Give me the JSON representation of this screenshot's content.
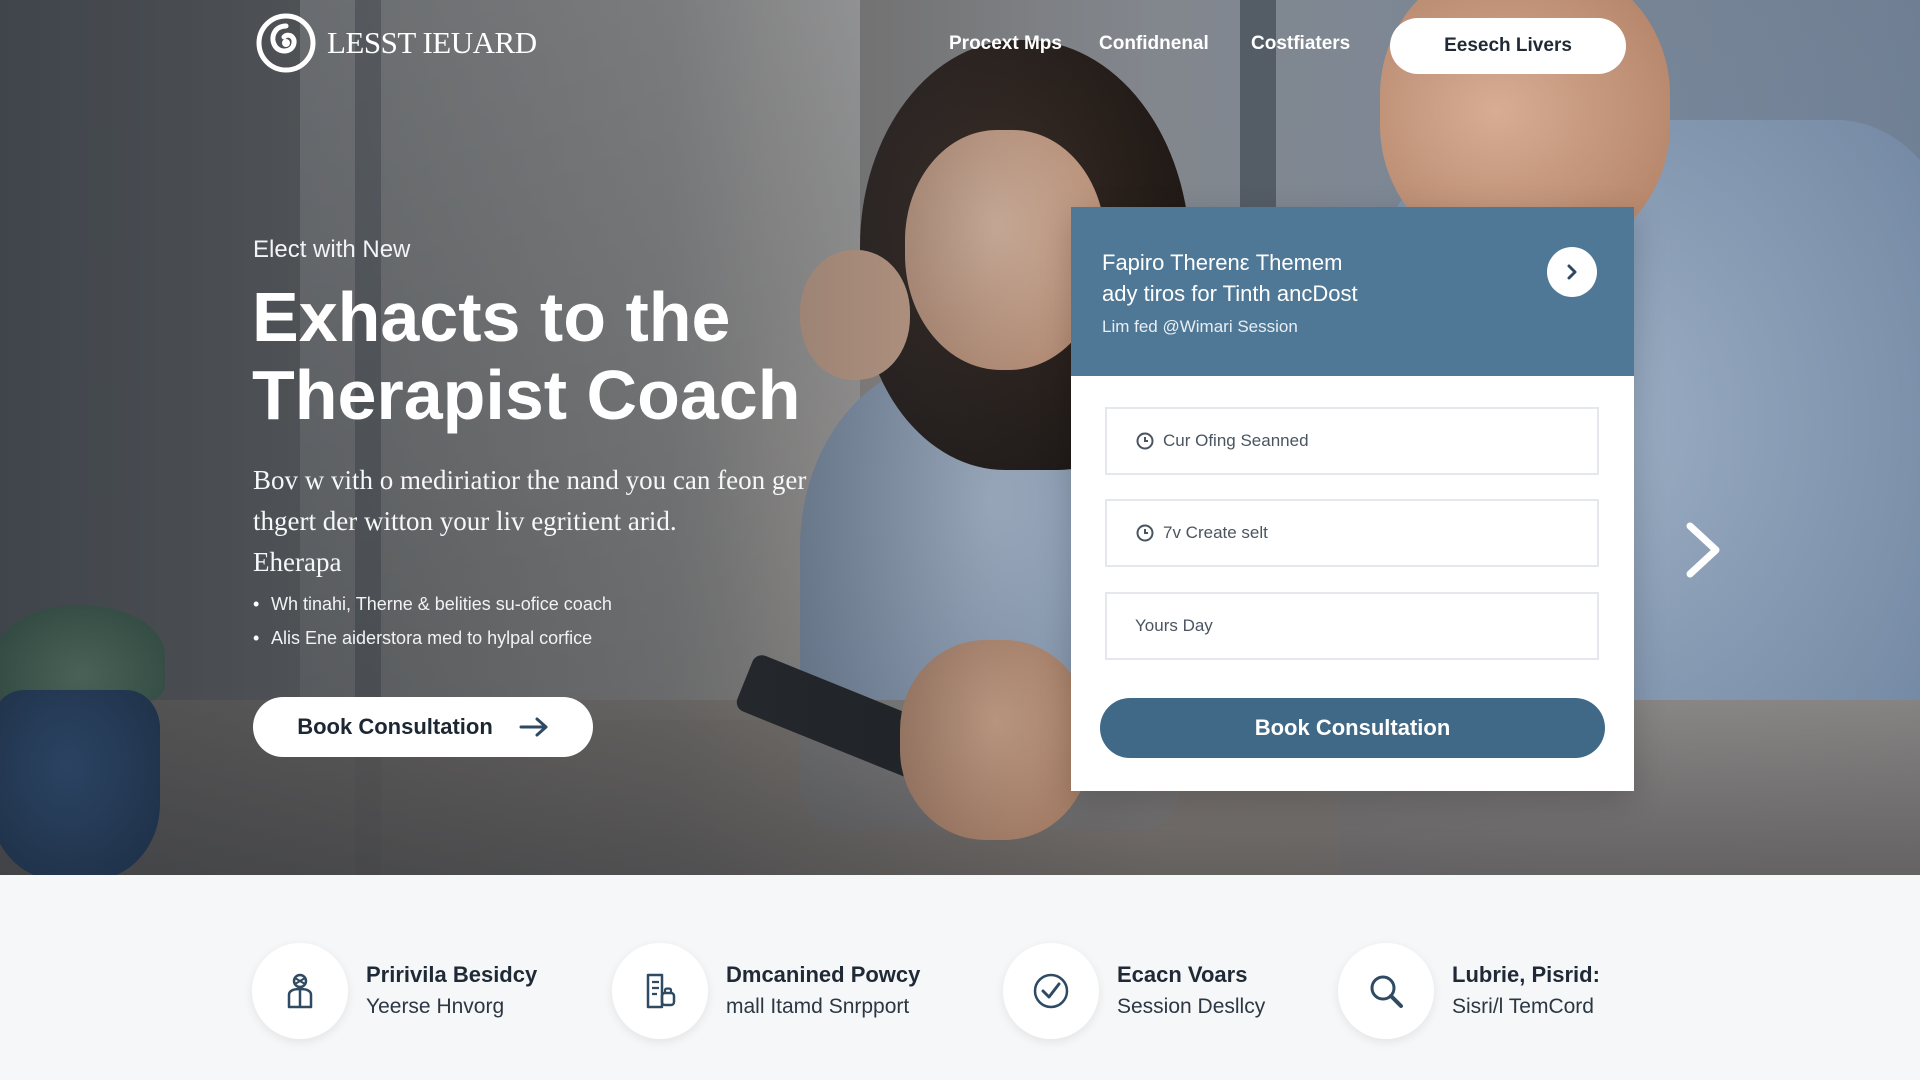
{
  "brand": {
    "logo_text": "LESST IEUARD"
  },
  "nav": {
    "links": [
      "Procext Mps",
      "Confidnenal",
      "Costfiaters"
    ],
    "cta_label": "Eesech Livers"
  },
  "hero": {
    "eyebrow": "Elect with New",
    "title_line1": "Exhacts to the",
    "title_line2": "Therapist Coach",
    "subtitle": [
      "Bov w vith o mediriatior the nand you can feon ger",
      "thgert der witton your liv egritient arid.",
      "Eherapa"
    ],
    "bullets": [
      "Wh tinahi, Therne & belities su-ofice coach",
      "Alis Ene aiderstora med to hylpal corfice"
    ],
    "cta_label": "Book Consultation"
  },
  "booking": {
    "title_lines": [
      "Fapiro Therenε Themem",
      "ady tiros for Tinth ancDost"
    ],
    "note": "Lim fed @Wimari Session",
    "fields": [
      {
        "label": "Cur Ofing Seanned",
        "icon": "clock-icon"
      },
      {
        "label": "7v Create selt",
        "icon": "clock-icon"
      },
      {
        "label": "Yours Day",
        "icon": ""
      }
    ],
    "cta_label": "Book Consultation"
  },
  "features": [
    {
      "title": "Pririvila Besidcy",
      "subtitle": "Yeerse Hnvorg",
      "icon": "person-icon"
    },
    {
      "title": "Dmcanined Powcy",
      "subtitle": "mall Itamd Snrpport",
      "icon": "document-icon"
    },
    {
      "title": "Ecacn Voars",
      "subtitle": "Session Desllcy",
      "icon": "check-circle-icon"
    },
    {
      "title": "Lubrie, Pisrid:",
      "subtitle": "Sisri/l TemCord",
      "icon": "search-icon"
    }
  ],
  "colors": {
    "card_header": "#4f7896",
    "primary_button": "#3f6987",
    "text_dark": "#1f2a36"
  }
}
